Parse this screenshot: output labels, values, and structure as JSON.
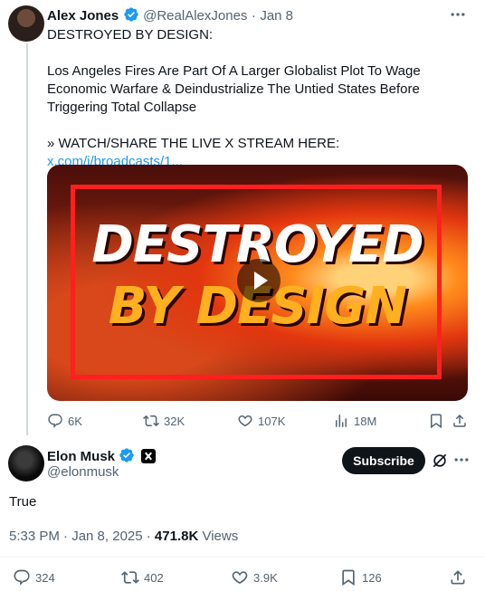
{
  "quoted_tweet": {
    "author_name": "Alex Jones",
    "author_handle": "@RealAlexJones",
    "separator": "·",
    "date": "Jan 8",
    "text_lines": [
      "DESTROYED BY DESIGN:",
      "Los Angeles Fires Are Part Of A Larger Globalist Plot To Wage Economic Warfare & Deindustrialize The Untied States Before Triggering Total Collapse",
      "» WATCH/SHARE THE LIVE X STREAM HERE:"
    ],
    "link_text": "x.com/i/broadcasts/1...",
    "media": {
      "title_line1": "DESTROYED",
      "title_line2": "BY DESIGN"
    },
    "actions": {
      "replies": "6K",
      "reposts": "32K",
      "likes": "107K",
      "views": "18M"
    }
  },
  "reply": {
    "author_name": "Elon Musk",
    "author_handle": "@elonmusk",
    "subscribe_label": "Subscribe",
    "text": "True",
    "timestamp": "5:33 PM · Jan 8, 2025 · ",
    "view_count": "471.8K",
    "views_label": " Views",
    "actions": {
      "replies": "324",
      "reposts": "402",
      "likes": "3.9K",
      "bookmarks": "126"
    }
  },
  "colors": {
    "accent": "#1d9bf0",
    "muted": "#536471",
    "text": "#0f1419",
    "thread_line": "#cfd9de"
  },
  "icons": [
    "more-icon",
    "verified-badge-icon",
    "play-icon",
    "reply-icon",
    "repost-icon",
    "like-icon",
    "views-icon",
    "bookmark-icon",
    "share-icon",
    "x-affiliate-badge",
    "grok-icon"
  ]
}
